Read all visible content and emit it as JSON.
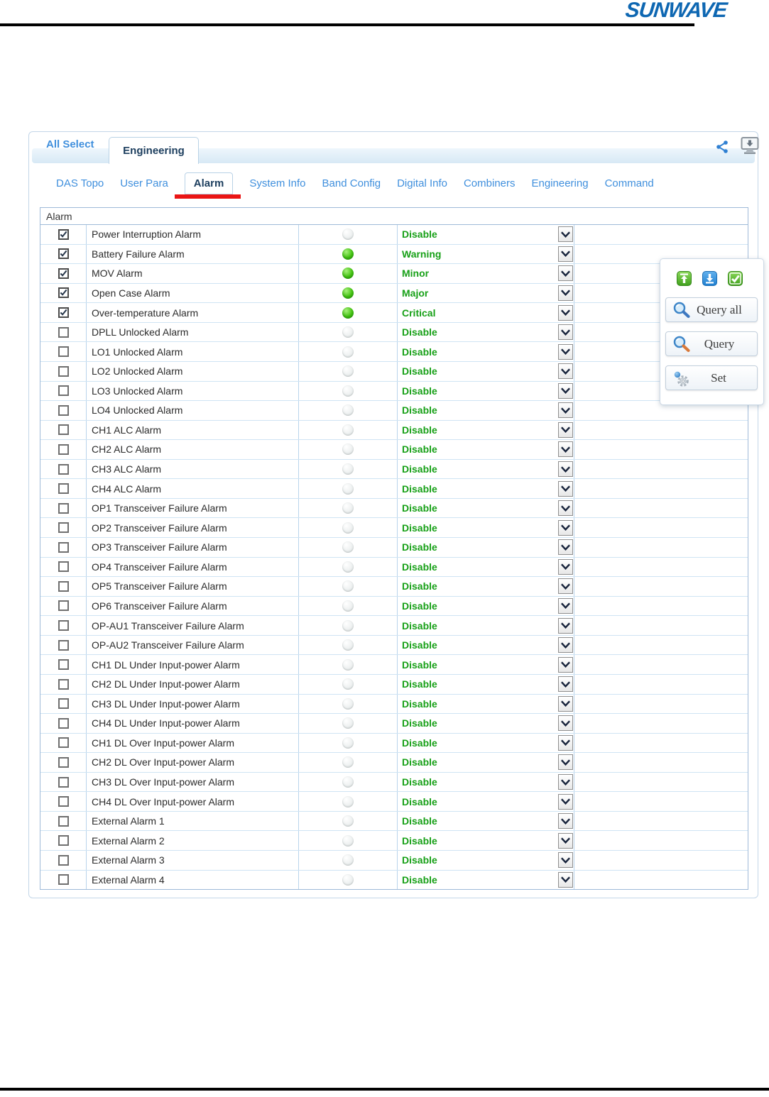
{
  "logo_text": "SUNWAVE",
  "header": {
    "all_select_label": "All Select",
    "window_tab_label": "Engineering"
  },
  "nav": {
    "tabs": [
      "DAS Topo",
      "User Para",
      "Alarm",
      "System Info",
      "Band Config",
      "Digital Info",
      "Combiners",
      "Engineering",
      "Command"
    ],
    "active_tab": "Alarm"
  },
  "table": {
    "header": "Alarm",
    "rows": [
      {
        "name": "Power Interruption Alarm",
        "checked": true,
        "led": "off",
        "status": "Disable"
      },
      {
        "name": "Battery Failure Alarm",
        "checked": true,
        "led": "green",
        "status": "Warning"
      },
      {
        "name": "MOV Alarm",
        "checked": true,
        "led": "green",
        "status": "Minor"
      },
      {
        "name": "Open Case Alarm",
        "checked": true,
        "led": "green",
        "status": "Major"
      },
      {
        "name": "Over-temperature Alarm",
        "checked": true,
        "led": "green",
        "status": "Critical"
      },
      {
        "name": "DPLL Unlocked Alarm",
        "checked": false,
        "led": "off",
        "status": "Disable"
      },
      {
        "name": "LO1 Unlocked Alarm",
        "checked": false,
        "led": "off",
        "status": "Disable"
      },
      {
        "name": "LO2 Unlocked Alarm",
        "checked": false,
        "led": "off",
        "status": "Disable"
      },
      {
        "name": "LO3 Unlocked Alarm",
        "checked": false,
        "led": "off",
        "status": "Disable"
      },
      {
        "name": "LO4 Unlocked Alarm",
        "checked": false,
        "led": "off",
        "status": "Disable"
      },
      {
        "name": "CH1 ALC Alarm",
        "checked": false,
        "led": "off",
        "status": "Disable"
      },
      {
        "name": "CH2 ALC Alarm",
        "checked": false,
        "led": "off",
        "status": "Disable"
      },
      {
        "name": "CH3 ALC Alarm",
        "checked": false,
        "led": "off",
        "status": "Disable"
      },
      {
        "name": "CH4 ALC Alarm",
        "checked": false,
        "led": "off",
        "status": "Disable"
      },
      {
        "name": "OP1 Transceiver Failure Alarm",
        "checked": false,
        "led": "off",
        "status": "Disable"
      },
      {
        "name": "OP2 Transceiver Failure Alarm",
        "checked": false,
        "led": "off",
        "status": "Disable"
      },
      {
        "name": "OP3 Transceiver Failure Alarm",
        "checked": false,
        "led": "off",
        "status": "Disable"
      },
      {
        "name": "OP4 Transceiver Failure Alarm",
        "checked": false,
        "led": "off",
        "status": "Disable"
      },
      {
        "name": "OP5 Transceiver Failure Alarm",
        "checked": false,
        "led": "off",
        "status": "Disable"
      },
      {
        "name": "OP6 Transceiver Failure Alarm",
        "checked": false,
        "led": "off",
        "status": "Disable"
      },
      {
        "name": "OP-AU1 Transceiver Failure Alarm",
        "checked": false,
        "led": "off",
        "status": "Disable"
      },
      {
        "name": "OP-AU2 Transceiver Failure Alarm",
        "checked": false,
        "led": "off",
        "status": "Disable"
      },
      {
        "name": "CH1 DL Under Input-power Alarm",
        "checked": false,
        "led": "off",
        "status": "Disable"
      },
      {
        "name": "CH2 DL Under Input-power Alarm",
        "checked": false,
        "led": "off",
        "status": "Disable"
      },
      {
        "name": "CH3 DL Under Input-power Alarm",
        "checked": false,
        "led": "off",
        "status": "Disable"
      },
      {
        "name": "CH4 DL Under Input-power Alarm",
        "checked": false,
        "led": "off",
        "status": "Disable"
      },
      {
        "name": "CH1 DL Over Input-power Alarm",
        "checked": false,
        "led": "off",
        "status": "Disable"
      },
      {
        "name": "CH2 DL Over Input-power Alarm",
        "checked": false,
        "led": "off",
        "status": "Disable"
      },
      {
        "name": "CH3 DL Over Input-power Alarm",
        "checked": false,
        "led": "off",
        "status": "Disable"
      },
      {
        "name": "CH4 DL Over Input-power Alarm",
        "checked": false,
        "led": "off",
        "status": "Disable"
      },
      {
        "name": "External Alarm 1",
        "checked": false,
        "led": "off",
        "status": "Disable"
      },
      {
        "name": "External Alarm 2",
        "checked": false,
        "led": "off",
        "status": "Disable"
      },
      {
        "name": "External Alarm 3",
        "checked": false,
        "led": "off",
        "status": "Disable"
      },
      {
        "name": "External Alarm 4",
        "checked": false,
        "led": "off",
        "status": "Disable"
      }
    ]
  },
  "side_panel": {
    "mini_icons": [
      "upload-icon",
      "download-icon",
      "select-all-icon"
    ],
    "buttons": [
      {
        "label": "Query all",
        "icon": "magnifier-blue-icon"
      },
      {
        "label": "Query",
        "icon": "magnifier-orange-icon"
      },
      {
        "label": "Set",
        "icon": "set-gear-icon"
      }
    ]
  },
  "colors": {
    "tab_blue": "#3f8fdd",
    "active_tab_text": "#1c3e5e",
    "status_green": "#17a017",
    "led_green": "#46c513",
    "underline_red": "#ea1515",
    "logo_blue": "#0e67b2"
  }
}
